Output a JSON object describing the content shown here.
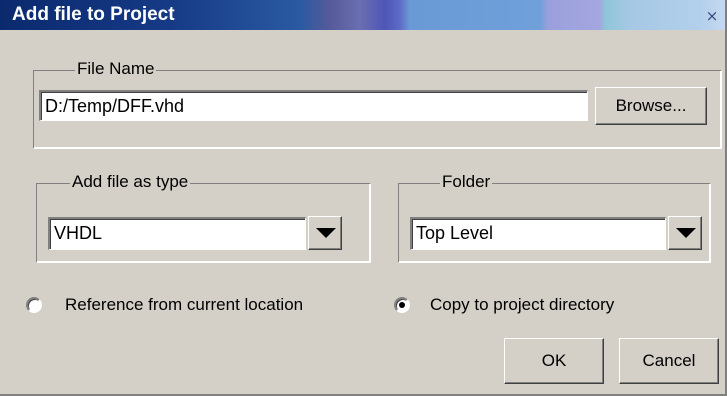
{
  "window": {
    "title": "Add file to Project",
    "close_glyph": "×"
  },
  "file_name_group": {
    "label": "File Name",
    "value": "D:/Temp/DFF.vhd",
    "browse_label": "Browse..."
  },
  "type_group": {
    "label": "Add file as type",
    "selected": "VHDL"
  },
  "folder_group": {
    "label": "Folder",
    "selected": "Top Level"
  },
  "options": {
    "reference_label": "Reference from current location",
    "copy_label": "Copy to project directory",
    "selected": "copy"
  },
  "buttons": {
    "ok_label": "OK",
    "cancel_label": "Cancel"
  }
}
